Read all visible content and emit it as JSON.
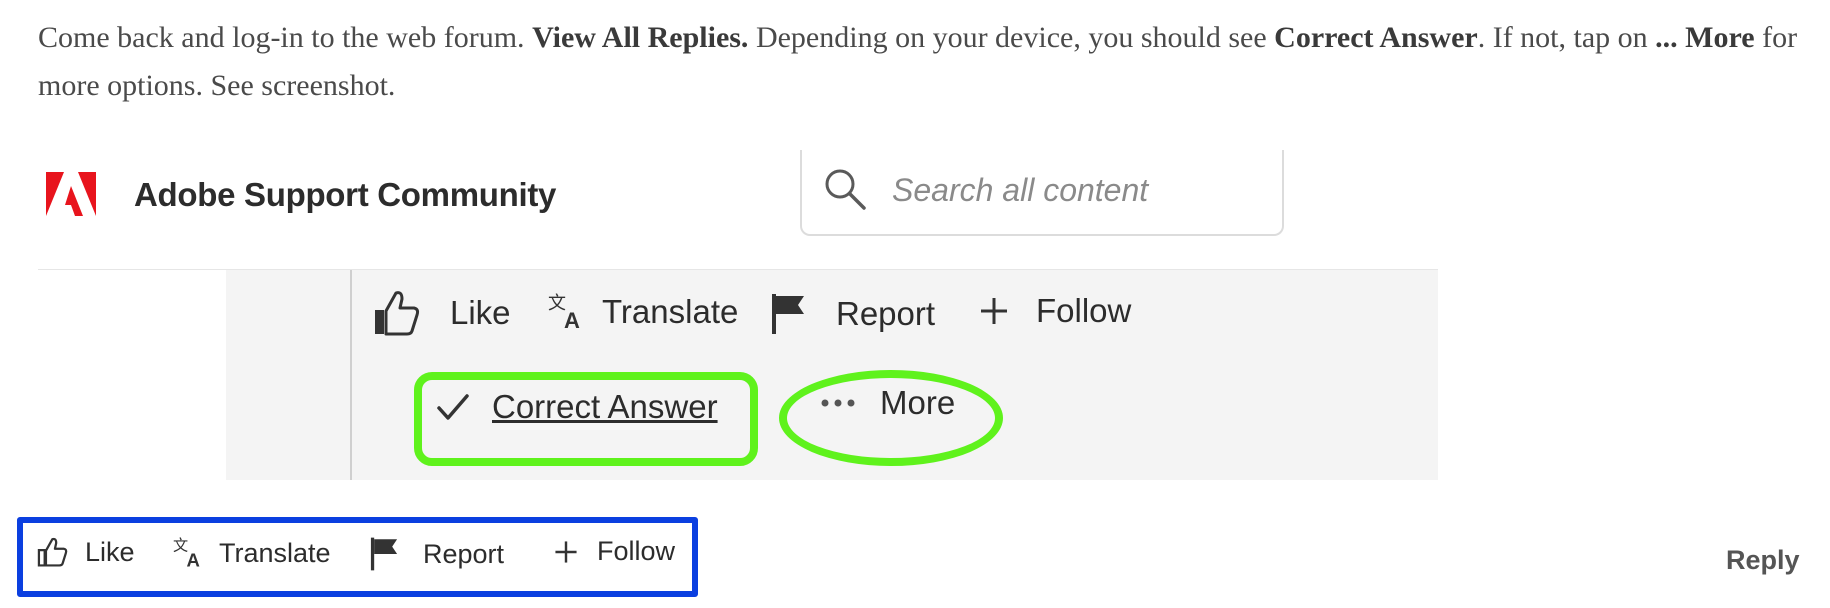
{
  "instructions": {
    "part1": "Come back and log-in to the web forum.   ",
    "bold1": "View All Replies.",
    "part2": " Depending on your device, you should see  ",
    "bold2": "Correct Answer",
    "part3": ".  If not, tap on ",
    "bold3": "...  More",
    "part4": " for more options.   See screenshot."
  },
  "community": {
    "brand": "Adobe Support Community",
    "search_placeholder": "Search all content"
  },
  "zoomed_actions": {
    "like": "Like",
    "translate": "Translate",
    "report": "Report",
    "follow": "Follow",
    "correct_answer": "Correct Answer",
    "more": "More"
  },
  "bottom_actions": {
    "like": "Like",
    "translate": "Translate",
    "report": "Report",
    "follow": "Follow",
    "reply": "Reply"
  },
  "colors": {
    "highlight_green": "#5ff21c",
    "highlight_blue": "#0b3fe0",
    "adobe_red": "#e8141d"
  },
  "icons": [
    "adobe-logo",
    "search-icon",
    "thumbs-up-icon",
    "translate-icon",
    "flag-icon",
    "plus-icon",
    "checkmark-icon",
    "ellipsis-icon"
  ]
}
